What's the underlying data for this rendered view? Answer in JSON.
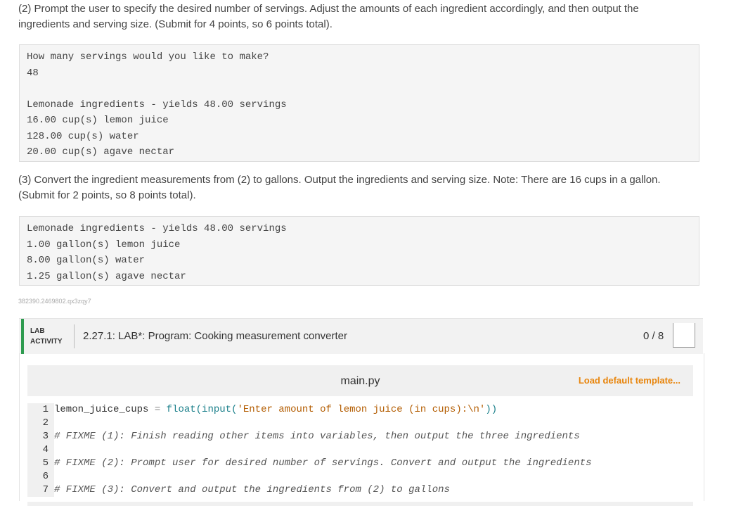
{
  "step2": {
    "text": "(2) Prompt the user to specify the desired number of servings. Adjust the amounts of each ingredient accordingly, and then output the ingredients and serving size. (Submit for 4 points, so 6 points total).",
    "output": [
      "How many servings would you like to make?",
      "48",
      "",
      "Lemonade ingredients - yields 48.00 servings",
      "16.00 cup(s) lemon juice",
      "128.00 cup(s) water",
      "20.00 cup(s) agave nectar"
    ]
  },
  "step3": {
    "text": "(3) Convert the ingredient measurements from (2) to gallons. Output the ingredients and serving size. Note: There are 16 cups in a gallon. (Submit for 2 points, so 8 points total).",
    "output": [
      "Lemonade ingredients - yields 48.00 servings",
      "1.00 gallon(s) lemon juice",
      "8.00 gallon(s) water",
      "1.25 gallon(s) agave nectar"
    ]
  },
  "small_id": "382390.2469802.qx3zqy7",
  "lab": {
    "label_line1": "LAB",
    "label_line2": "ACTIVITY",
    "title": "2.27.1: LAB*: Program: Cooking measurement converter",
    "score": "0 / 8"
  },
  "editor": {
    "filename": "main.py",
    "load_template": "Load default template...",
    "line1_var": "lemon_juice_cups",
    "line1_eq": "=",
    "line1_fn": "float(input(",
    "line1_str": "'Enter amount of lemon juice (in cups):\\n'",
    "line1_end": "))",
    "line3": "# FIXME (1): Finish reading other items into variables, then output the three ingredients",
    "line5": "# FIXME (2): Prompt user for desired number of servings. Convert and output the ingredients",
    "line7": "# FIXME (3): Convert and output the ingredients from (2) to gallons",
    "line_numbers": [
      "1",
      "2",
      "3",
      "4",
      "5",
      "6",
      "7"
    ]
  }
}
